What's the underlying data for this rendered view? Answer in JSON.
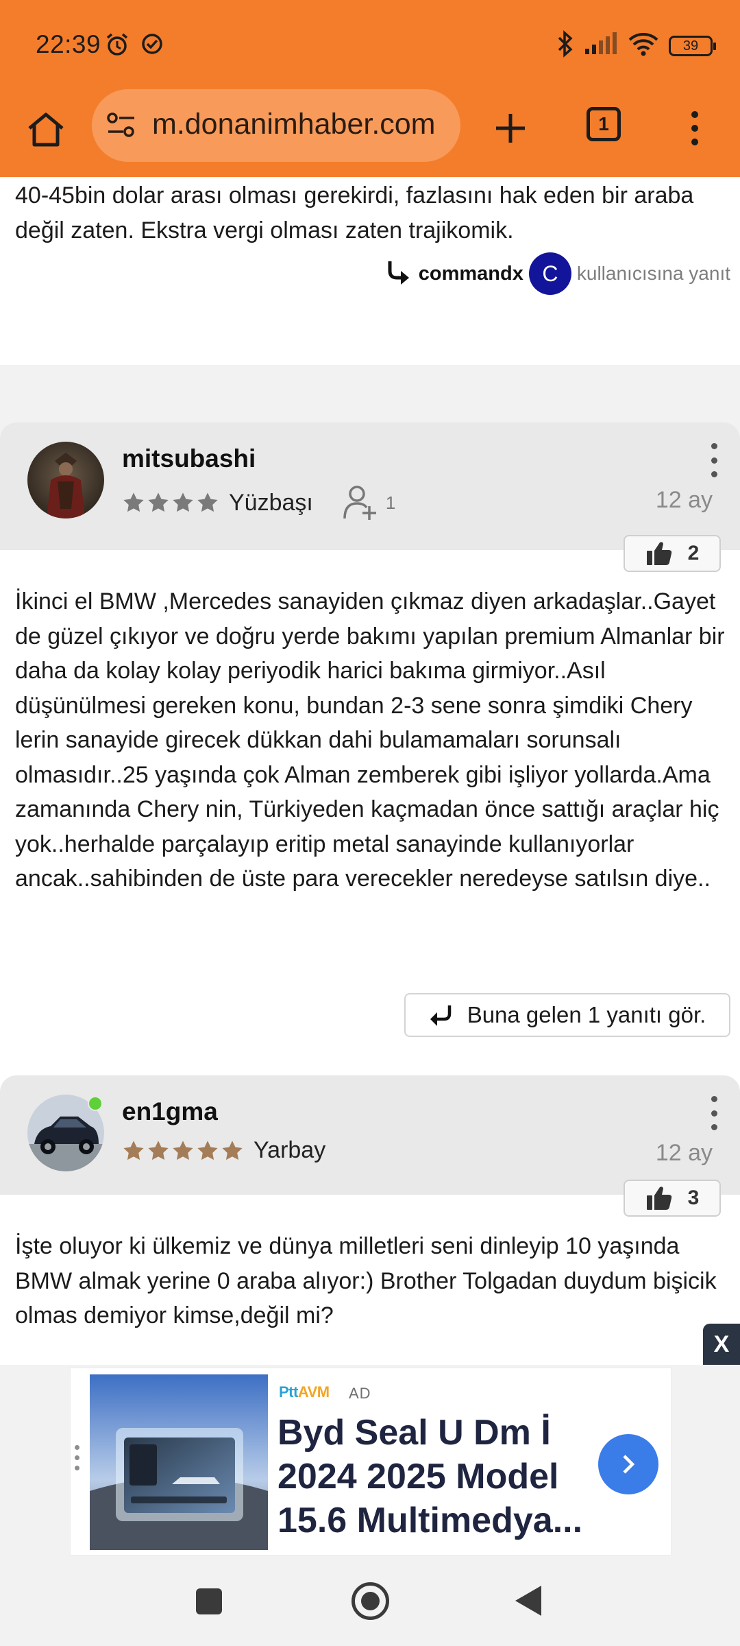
{
  "status_bar": {
    "time": "22:39",
    "left_icons": [
      "alarm-icon",
      "check-circle-icon"
    ],
    "right_icons": [
      "bluetooth-icon",
      "signal-icon",
      "wifi-icon",
      "battery-icon"
    ],
    "battery_level": "39"
  },
  "browser": {
    "url": "m.donanimhaber.com",
    "tab_count": "1",
    "theme_color": "#f47d2b"
  },
  "prev_post": {
    "text": "40-45bin dolar arası olması gerekirdi, fazlasını hak eden bir araba değil zaten. Ekstra vergi olması zaten trajikomik.",
    "reply_to_user": "commandx",
    "reply_to_avatar_letter": "C",
    "reply_suffix": "kullanıcısına yanıt"
  },
  "posts": [
    {
      "username": "mitsubashi",
      "rank": "Yüzbaşı",
      "stars": 4,
      "followers": "1",
      "age": "12 ay",
      "likes": "2",
      "text": "İkinci el BMW ,Mercedes sanayiden çıkmaz diyen arkadaşlar..Gayet de güzel çıkıyor ve doğru yerde bakımı yapılan premium Almanlar bir daha da kolay kolay periyodik harici bakıma girmiyor..Asıl düşünülmesi gereken konu, bundan 2-3 sene sonra şimdiki Chery lerin sanayide girecek dükkan dahi bulamamaları sorunsalı olmasıdır..25 yaşında çok Alman zemberek gibi işliyor yollarda.Ama zamanında Chery nin, Türkiyeden kaçmadan önce sattığı araçlar hiç yok..herhalde parçalayıp eritip metal sanayinde kullanıyorlar ancak..sahibinden de üste para verecekler neredeyse satılsın diye..",
      "see_replies": "Buna gelen 1 yanıtı gör."
    },
    {
      "username": "en1gma",
      "rank": "Yarbay",
      "stars": 5,
      "online": true,
      "age": "12 ay",
      "likes": "3",
      "text": "İşte oluyor ki ülkemiz ve dünya milletleri seni dinleyip 10 yaşında BMW almak yerine 0 araba alıyor:) Brother Tolgadan duydum bişicik olmas demiyor kimse,değil mi?"
    }
  ],
  "ad": {
    "close_label": "X",
    "brand_a": "Ptt",
    "brand_b": "AVM",
    "tag": "AD",
    "title": "Byd Seal U Dm İ 2024 2025 Model 15.6 Multimedya..."
  },
  "nav_bar": {
    "buttons": [
      "recent-apps-icon",
      "home-icon",
      "back-icon"
    ]
  }
}
